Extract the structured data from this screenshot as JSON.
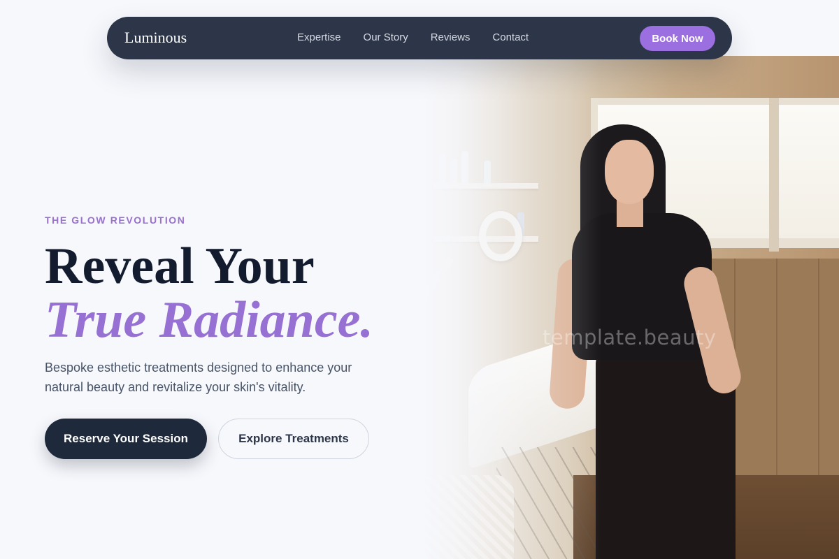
{
  "nav": {
    "brand": "Luminous",
    "links": [
      "Expertise",
      "Our Story",
      "Reviews",
      "Contact"
    ],
    "cta": "Book Now"
  },
  "hero": {
    "eyebrow": "THE GLOW REVOLUTION",
    "headline_line1": "Reveal Your",
    "headline_line2": "True Radiance.",
    "subtitle": "Bespoke esthetic treatments designed to enhance your natural beauty and revitalize your skin's vitality.",
    "primary_cta": "Reserve Your Session",
    "secondary_cta": "Explore Treatments",
    "image_watermark": "template.beauty"
  },
  "colors": {
    "accent": "#9b6fe0",
    "navy": "#1e293b",
    "nav_bg": "#2d3648",
    "page_bg": "#f7f8fc"
  }
}
